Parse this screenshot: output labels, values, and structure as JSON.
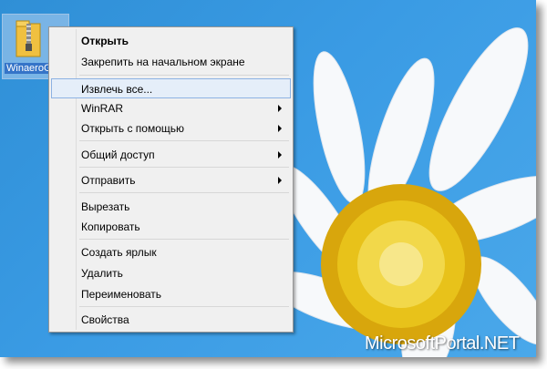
{
  "desktop": {
    "icon_label": "WinaeroG",
    "watermark": "MicrosoftPortal.NET"
  },
  "context_menu": {
    "items": [
      {
        "label": "Открыть",
        "bold": true
      },
      {
        "label": "Закрепить на начальном экране"
      },
      {
        "label": "Извлечь все...",
        "highlighted": true
      },
      {
        "label": "WinRAR",
        "submenu": true
      },
      {
        "label": "Открыть с помощью",
        "submenu": true
      },
      {
        "label": "Общий доступ",
        "submenu": true
      },
      {
        "label": "Отправить",
        "submenu": true
      },
      {
        "label": "Вырезать"
      },
      {
        "label": "Копировать"
      },
      {
        "label": "Создать ярлык"
      },
      {
        "label": "Удалить"
      },
      {
        "label": "Переименовать"
      },
      {
        "label": "Свойства"
      }
    ]
  },
  "colors": {
    "wallpaper_sky": "#3a9be4",
    "highlight_fill": "#e5eef9",
    "highlight_border": "#8db2e3",
    "menu_bg": "#f0f0f0"
  }
}
